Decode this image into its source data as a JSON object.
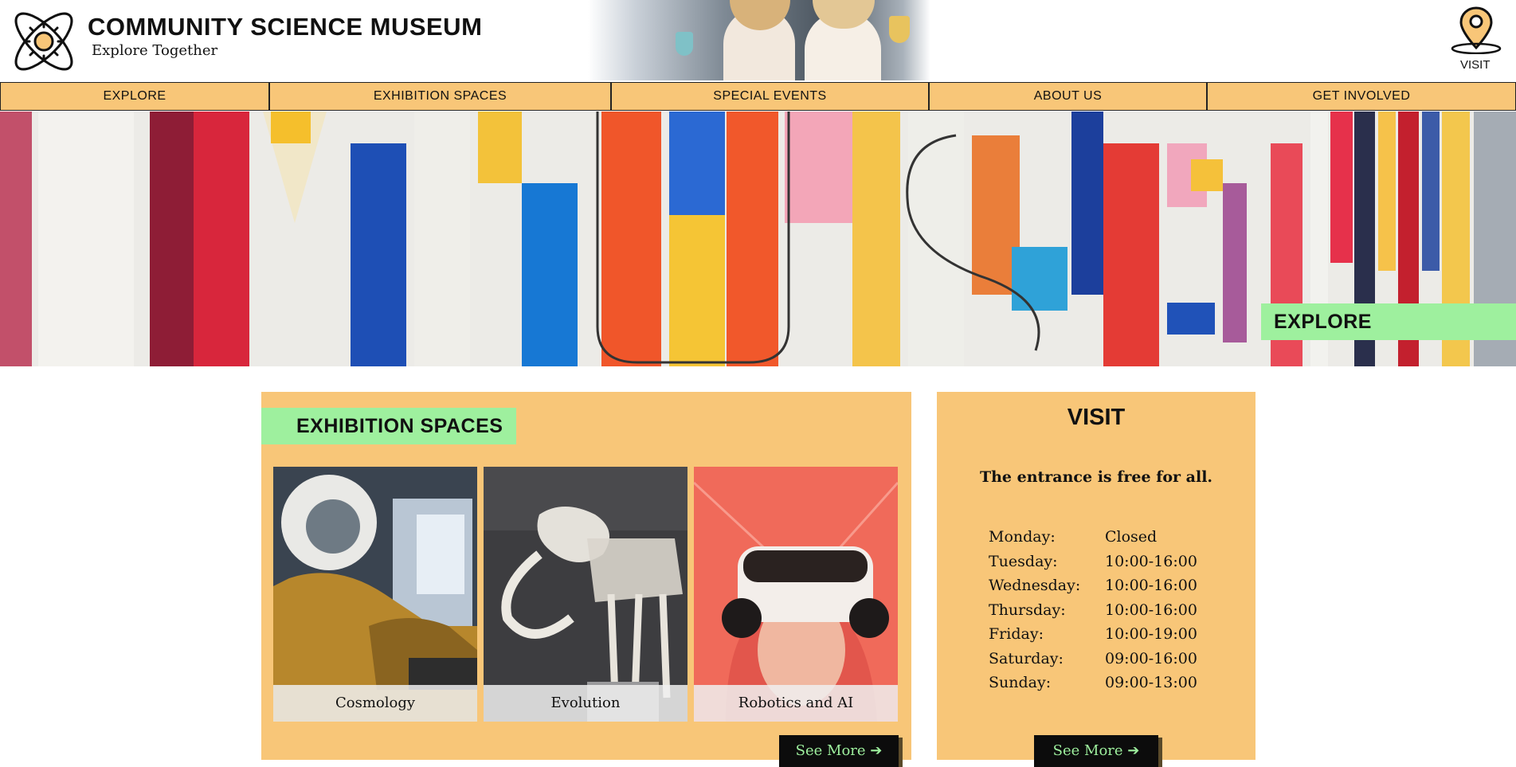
{
  "header": {
    "title": "COMMUNITY SCIENCE MUSEUM",
    "tagline": "Explore Together",
    "logo_icon": "atom-sun-icon",
    "visit_icon": "map-pin-icon",
    "visit_label": "VISIT"
  },
  "nav": {
    "items": [
      {
        "label": "EXPLORE"
      },
      {
        "label": "EXHIBITION SPACES"
      },
      {
        "label": "SPECIAL EVENTS"
      },
      {
        "label": "ABOUT US"
      },
      {
        "label": "GET INVOLVED"
      }
    ]
  },
  "hero": {
    "badge": "EXPLORE"
  },
  "exhibitions": {
    "heading": "EXHIBITION SPACES",
    "cards": [
      {
        "caption": "Cosmology"
      },
      {
        "caption": "Evolution"
      },
      {
        "caption": "Robotics and AI"
      }
    ],
    "more_label": "See More ➔"
  },
  "visit": {
    "title": "VISIT",
    "free_text": "The entrance is free for all.",
    "hours": [
      {
        "day": "Monday:",
        "time": "Closed"
      },
      {
        "day": "Tuesday:",
        "time": "10:00-16:00"
      },
      {
        "day": "Wednesday:",
        "time": "10:00-16:00"
      },
      {
        "day": "Thursday:",
        "time": "10:00-16:00"
      },
      {
        "day": "Friday:",
        "time": "10:00-19:00"
      },
      {
        "day": "Saturday:",
        "time": "09:00-16:00"
      },
      {
        "day": "Sunday:",
        "time": "09:00-13:00"
      }
    ],
    "more_label": "See More ➔"
  },
  "colors": {
    "accent": "#f8c678",
    "highlight": "#9ef09e",
    "button": "#0c0c0c"
  }
}
